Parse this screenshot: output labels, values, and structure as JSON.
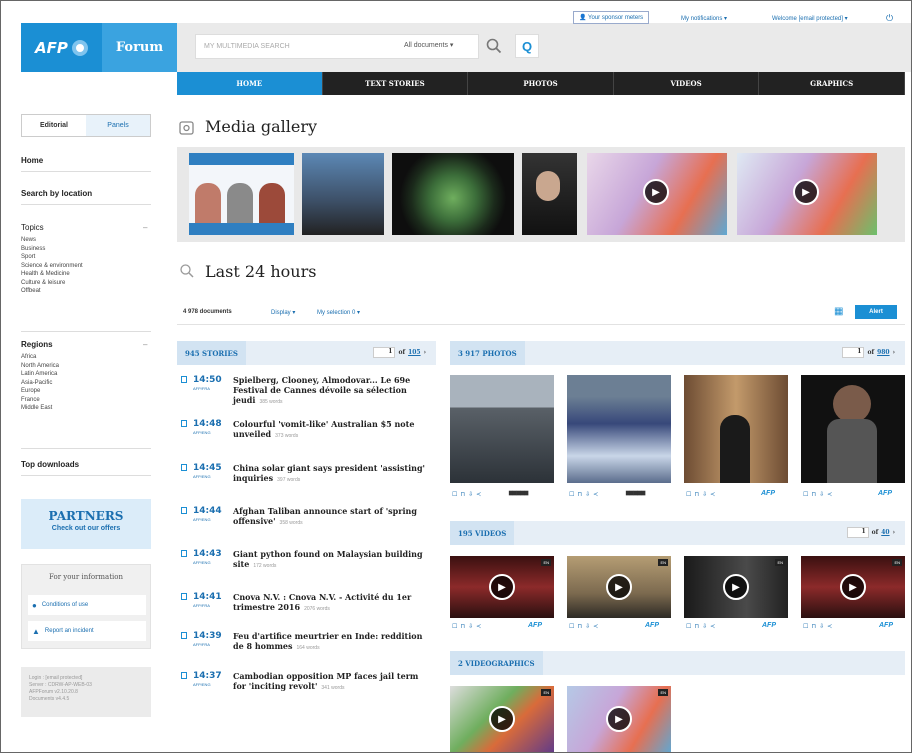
{
  "brand": {
    "logo": "AFP",
    "product": "Forum"
  },
  "header": {
    "sponsor_label": "Your sponsor meters",
    "notifications_label": "My notifications",
    "welcome_label": "Welcome [email protected]",
    "search_placeholder": "MY MULTIMEDIA SEARCH",
    "search_scope": "All documents"
  },
  "nav": {
    "tabs": [
      "HOME",
      "TEXT STORIES",
      "PHOTOS",
      "VIDEOS",
      "GRAPHICS"
    ],
    "active": 0
  },
  "sidebar": {
    "segments": [
      "Editorial",
      "Panels"
    ],
    "home": "Home",
    "search_by_location": "Search by location",
    "topics_title": "Topics",
    "topics": [
      "News",
      "Business",
      "Sport",
      "Science & environment",
      "Health & Medicine",
      "Culture & leisure",
      "Offbeat"
    ],
    "regions_title": "Regions",
    "regions": [
      "Africa",
      "North America",
      "Latin America",
      "Asia-Pacific",
      "Europe",
      "France",
      "Middle East"
    ],
    "top_downloads": "Top downloads",
    "partners_title": "PARTNERS",
    "partners_sub": "Check out our offers",
    "info_title": "For your information",
    "info_items": [
      "Conditions of use",
      "Report an incident"
    ],
    "login_lines": [
      "Login : [email protected]",
      "Server : CDRW-AP-WEB-03",
      "AFPForum v2.10.20.8",
      "Documents v4.4.5"
    ]
  },
  "main": {
    "gallery_title": "Media gallery",
    "last24_title": "Last 24 hours",
    "doc_count": "4 978 documents",
    "display_label": "Display",
    "selection_label": "My selection 0",
    "alert_label": "Alert",
    "stories": {
      "label": "945 STORIES",
      "page": "1",
      "of": "of",
      "total": "105"
    },
    "photos": {
      "label": "3 917 PHOTOS",
      "page": "1",
      "of": "of",
      "total": "980"
    },
    "videos": {
      "label": "195 VIDEOS",
      "page": "1",
      "of": "of",
      "total": "40"
    },
    "videographics": {
      "label": "2 VIDEOGRAPHICS"
    },
    "story_items": [
      {
        "time": "14:50",
        "sub": "AFP/FRA",
        "title": "Spielberg, Clooney, Almodovar... Le 69e Festival de Cannes dévoile sa sélection jeudi",
        "words": "385 words"
      },
      {
        "time": "14:48",
        "sub": "AFP/ENG",
        "title": "Colourful 'vomit-like' Australian $5 note unveiled",
        "words": "373 words"
      },
      {
        "time": "14:45",
        "sub": "AFP/ENG",
        "title": "China solar giant says president 'assisting' inquiries",
        "words": "397 words"
      },
      {
        "time": "14:44",
        "sub": "AFP/ENG",
        "title": "Afghan Taliban announce start of 'spring offensive'",
        "words": "358 words"
      },
      {
        "time": "14:43",
        "sub": "AFP/ENG",
        "title": "Giant python found on Malaysian building site",
        "words": "172 words"
      },
      {
        "time": "14:41",
        "sub": "AFP/FRA",
        "title": "Cnova N.V. : Cnova N.V. - Activité du 1er trimestre 2016",
        "words": "2076 words"
      },
      {
        "time": "14:39",
        "sub": "AFP/FRA",
        "title": "Feu d'artifice meurtrier en Inde: reddition de 8 hommes",
        "words": "164 words"
      },
      {
        "time": "14:37",
        "sub": "AFP/ENG",
        "title": "Cambodian opposition MP faces jail term for 'inciting revolt'",
        "words": "341 words"
      }
    ],
    "video_badge": "EN",
    "afp_mark": "AFP"
  }
}
